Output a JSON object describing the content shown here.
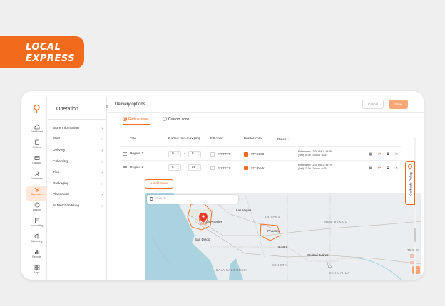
{
  "brand": {
    "line1": "LOCAL",
    "line2": "EXPRESS",
    "color": "#f26a1c"
  },
  "rail": {
    "items": [
      {
        "label": "Dashboard",
        "icon": "home-icon"
      },
      {
        "label": "Orders",
        "icon": "orders-icon"
      },
      {
        "label": "Catalog",
        "icon": "catalog-icon"
      },
      {
        "label": "Customers",
        "icon": "customers-icon"
      },
      {
        "label": "Operation",
        "icon": "operation-icon",
        "active": true
      },
      {
        "label": "Design",
        "icon": "design-icon"
      },
      {
        "label": "Accounting",
        "icon": "accounting-icon"
      },
      {
        "label": "Marketing",
        "icon": "marketing-icon"
      },
      {
        "label": "Reports",
        "icon": "reports-icon"
      },
      {
        "label": "Apps",
        "icon": "apps-icon"
      }
    ]
  },
  "sidebar": {
    "title": "Operation",
    "items": [
      "Store Information",
      "Staff",
      "Delivery",
      "Collecting",
      "Tips",
      "Packaging",
      "Placement",
      "AI Merchandising"
    ]
  },
  "header": {
    "title": "Delivery options",
    "cancel_label": "Cancel",
    "save_label": "Save"
  },
  "zone_tabs": {
    "radius": "Radius zone",
    "custom": "Custom zone"
  },
  "table": {
    "headers": {
      "title": "Title",
      "radius": "Radius min-max (mi)",
      "fill": "Fill color",
      "border": "Border color",
      "rules": "Rules"
    },
    "rows": [
      {
        "name": "Region 1",
        "min": "0",
        "max": "5",
        "fill_hex": "#FFFFFF",
        "border_hex": "#FF5C00",
        "rule_line1": "Entire week 12:00 AM-11:45 PM",
        "rule_line2": "(Self) $5.00 · 2hours · ≤$5"
      },
      {
        "name": "Region 2",
        "min": "5",
        "max": "20",
        "fill_hex": "#FFFFFF",
        "border_hex": "#FF5C00",
        "rule_line1": "Entire week 12:00 AM-11:45 PM",
        "rule_line2": "(Self) $7.00 · 2hours · ≤$5"
      }
    ],
    "add_label": "+ Add zone"
  },
  "map": {
    "search_placeholder": "Search",
    "labels": {
      "las_vegas": "Las Vegas",
      "los_angeles": "Los Angeles",
      "san_diego": "San Diego",
      "phoenix": "Phoenix",
      "tucson": "Tucson",
      "arizona": "ARIZONA",
      "new_mexico": "NEW MEXICO",
      "sonora": "SONORA",
      "chihuahua": "CHIHUAHUA",
      "ciudad_juarez": "Ciudad Juárez",
      "baja": "BAJA CALIFORNIA",
      "texas": "TEXAS"
    },
    "zoom_label": "+"
  },
  "curbside": {
    "label": "Curbside Pickup"
  }
}
